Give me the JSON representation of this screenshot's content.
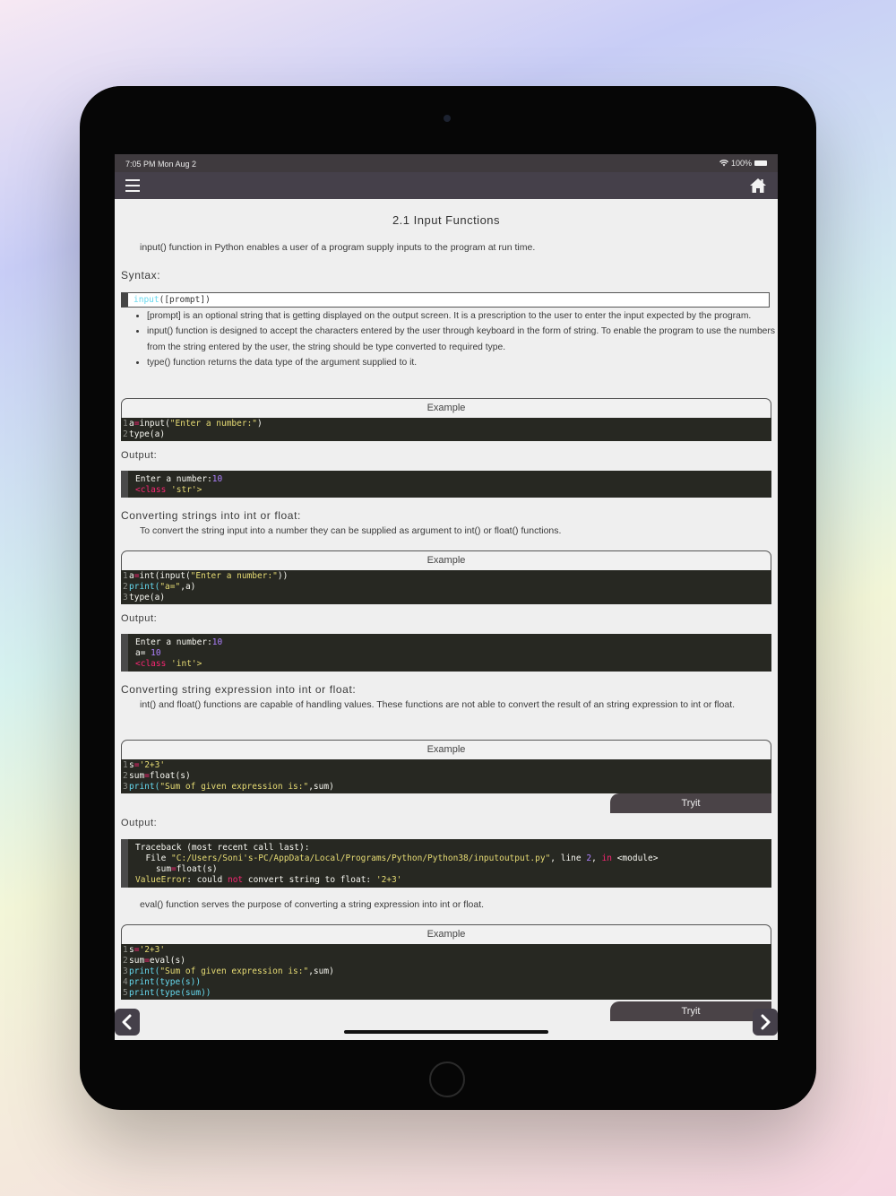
{
  "status": {
    "time_date": "7:05 PM   Mon Aug 2",
    "battery": "100%"
  },
  "page": {
    "title": "2.1 Input Functions",
    "intro": "input() function in Python enables a user of a program supply inputs to the program at run time.",
    "syntax_heading": "Syntax:",
    "syntax_fn": "input",
    "syntax_args": "([prompt])",
    "bullets": [
      "[prompt] is an optional string that is getting displayed on the output screen. It is a prescription to the user to enter the input expected by the program.",
      "input() function is designed to accept the characters entered by the user through keyboard in the form of string. To enable the program to use the numbers from the string entered by the user, the string should be type converted to required type.",
      "type() function returns the data type of the argument supplied to it."
    ],
    "example_label": "Example",
    "output_label": "Output:",
    "tryit_label": "Tryit",
    "heading_convert": "Converting strings into int or float:",
    "para_convert": "To convert the string input into a number they can be supplied as argument to int() or float() functions.",
    "heading_expr": "Converting string expression into int or float:",
    "para_expr": "int() and float() functions are capable of handling values. These functions are not able to convert the result of an string expression to int or float.",
    "para_eval": "eval() function serves the purpose of converting a string expression into int or float.",
    "ex1": {
      "l1a": "a",
      "l1b": "=",
      "l1c": "input(",
      "l1d": "\"Enter a number:\"",
      "l1e": ")",
      "l2": "type(a)",
      "out1a": "Enter a number:",
      "out1b": "10",
      "out2a": "<class ",
      "out2b": "'str'>"
    },
    "ex2": {
      "l1a": "a",
      "l1b": "=",
      "l1c": "int(input(",
      "l1d": "\"Enter a number:\"",
      "l1e": "))",
      "l2a": "print(",
      "l2b": "\"a=\"",
      "l2c": ",a)",
      "l3": "type(a)",
      "out1a": "Enter a number:",
      "out1b": "10",
      "out2a": "a=",
      "out2b": " 10",
      "out3a": "<class ",
      "out3b": "'int'>"
    },
    "ex3": {
      "l1a": "s",
      "l1b": "=",
      "l1c": "'2+3'",
      "l2a": "sum",
      "l2b": "=",
      "l2c": "float(s)",
      "l3a": "print(",
      "l3b": "\"Sum of given expression is:\"",
      "l3c": ",sum)",
      "tb1": "Traceback (most recent call last):",
      "tb2a": "  File ",
      "tb2b": "\"C:/Users/Soni's-PC/AppData/Local/Programs/Python/Python38/inputoutput.py\"",
      "tb2c": ", line ",
      "tb2d": "2",
      "tb2e": ", ",
      "tb2f": "in",
      "tb2g": " <module>",
      "tb3a": "    sum",
      "tb3b": "=",
      "tb3c": "float(s)",
      "tb4a": "ValueError",
      "tb4b": ": could ",
      "tb4c": "not",
      "tb4d": " convert string to float: ",
      "tb4e": "'2+3'"
    },
    "ex4": {
      "l1a": "s",
      "l1b": "=",
      "l1c": "'2+3'",
      "l2a": "sum",
      "l2b": "=",
      "l2c": "eval(s)",
      "l3a": "print(",
      "l3b": "\"Sum of given expression is:\"",
      "l3c": ",sum)",
      "l4": "print(type(s))",
      "l5": "print(type(sum))"
    },
    "line_numbers": [
      "1",
      "2",
      "3",
      "4",
      "5"
    ]
  }
}
